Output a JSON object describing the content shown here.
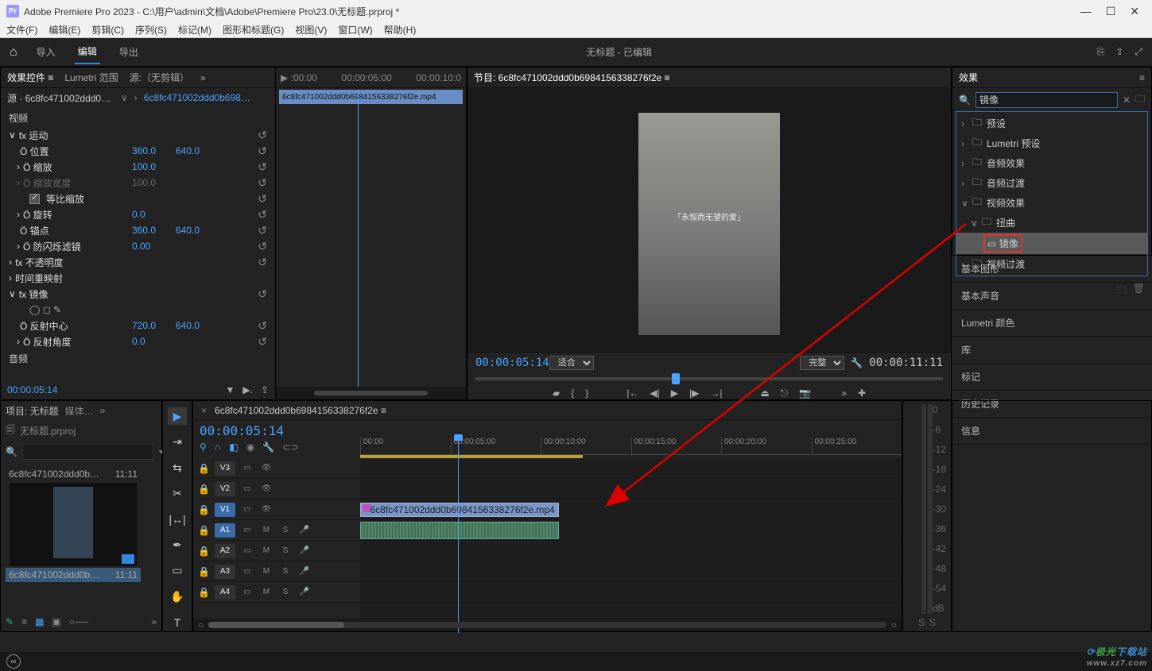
{
  "window": {
    "app_icon": "Pr",
    "title": "Adobe Premiere Pro 2023 - C:\\用户\\admin\\文档\\Adobe\\Premiere Pro\\23.0\\无标题.prproj *"
  },
  "menu": {
    "file": "文件(F)",
    "edit": "编辑(E)",
    "clip": "剪辑(C)",
    "sequence": "序列(S)",
    "markers": "标记(M)",
    "graphics": "图形和标题(G)",
    "view": "视图(V)",
    "window": "窗口(W)",
    "help": "帮助(H)"
  },
  "workspace": {
    "import": "导入",
    "edit": "编辑",
    "export": "导出",
    "center": "无标题 - 已编辑"
  },
  "effect_controls": {
    "tabs": {
      "ec": "效果控件",
      "lumetri": "Lumetri 范围",
      "source": "源:（无剪辑）"
    },
    "src1": "源 · 6c8fc471002ddd0b698…",
    "src2": "6c8fc471002ddd0b69841…",
    "ruler1": "▶ :00:00",
    "ruler2": "00:00:05:00",
    "ruler3": "00:00:10:0",
    "clip_label": "6c8fc471002ddd0b6984156338276f2e.mp4",
    "section_video": "视频",
    "motion": "fx  运动",
    "position": "Ö 位置",
    "position_x": "360.0",
    "position_y": "640.0",
    "scale": "Ö 缩放",
    "scale_v": "100.0",
    "scale_w": "Ö 缩放宽度",
    "scale_w_v": "100.0",
    "uniform": "等比缩放",
    "rotation": "Ö 旋转",
    "rotation_v": "0.0",
    "anchor": "Ö 锚点",
    "anchor_x": "360.0",
    "anchor_y": "640.0",
    "flicker": "Ö 防闪烁滤镜",
    "flicker_v": "0.00",
    "opacity": "fx  不透明度",
    "timeremap": "时间重映射",
    "mirror": "fx  镜像",
    "tools": "◯ ◻ ✎",
    "refl_center": "Ö 反射中心",
    "refl_x": "720.0",
    "refl_y": "640.0",
    "refl_angle": "Ö 反射角度",
    "refl_angle_v": "0.0",
    "section_audio": "音频",
    "footer_time": "00:00:05:14"
  },
  "program": {
    "title": "节目: 6c8fc471002ddd0b6984156338276f2e",
    "caption": "「永恒而无望的爱」",
    "time_left": "00:00:05:14",
    "fit": "适合",
    "full": "完整",
    "time_right": "00:00:11:11"
  },
  "effects": {
    "tab": "效果",
    "search": "镜像",
    "presets": "预设",
    "lumetri": "Lumetri 预设",
    "audio_fx": "音频效果",
    "audio_tr": "音频过渡",
    "video_fx": "视频效果",
    "distort": "扭曲",
    "mirror": "镜像",
    "video_tr": "视频过渡"
  },
  "right_panels": {
    "graphics": "基本图形",
    "sound": "基本声音",
    "lumetri": "Lumetri 颜色",
    "libraries": "库",
    "markers": "标记",
    "history": "历史记录",
    "info": "信息"
  },
  "project": {
    "tab": "项目: 无标题",
    "media": "媒体…",
    "bin": "无标题.prproj",
    "clip_name_short": "6c8fc471002ddd0b…",
    "duration1": "11:11",
    "duration2": "11:11"
  },
  "timeline": {
    "seq_name": "6c8fc471002ddd0b6984156338276f2e",
    "time": "00:00:05:14",
    "ruler": [
      "00:00",
      "00:00:05:00",
      "00:00:10:00",
      "00:00:15:00",
      "00:00:20:00",
      "00:00:25:00"
    ],
    "tracks": {
      "v3": "V3",
      "v2": "V2",
      "v1": "V1",
      "a1": "A1",
      "a2": "A2",
      "a3": "A3",
      "a4": "A4"
    },
    "clip_v": "6c8fc471002ddd0b6984156338276f2e.mp4 [V]"
  },
  "meter": {
    "labels": [
      "0",
      "-6",
      "-12",
      "-18",
      "-24",
      "-30",
      "-36",
      "-42",
      "-48",
      "-54",
      "dB"
    ],
    "solo": "S",
    "solo2": "S"
  },
  "watermark": {
    "brand": "极光",
    "suffix": "下载站",
    "url": "www.xz7.com"
  }
}
